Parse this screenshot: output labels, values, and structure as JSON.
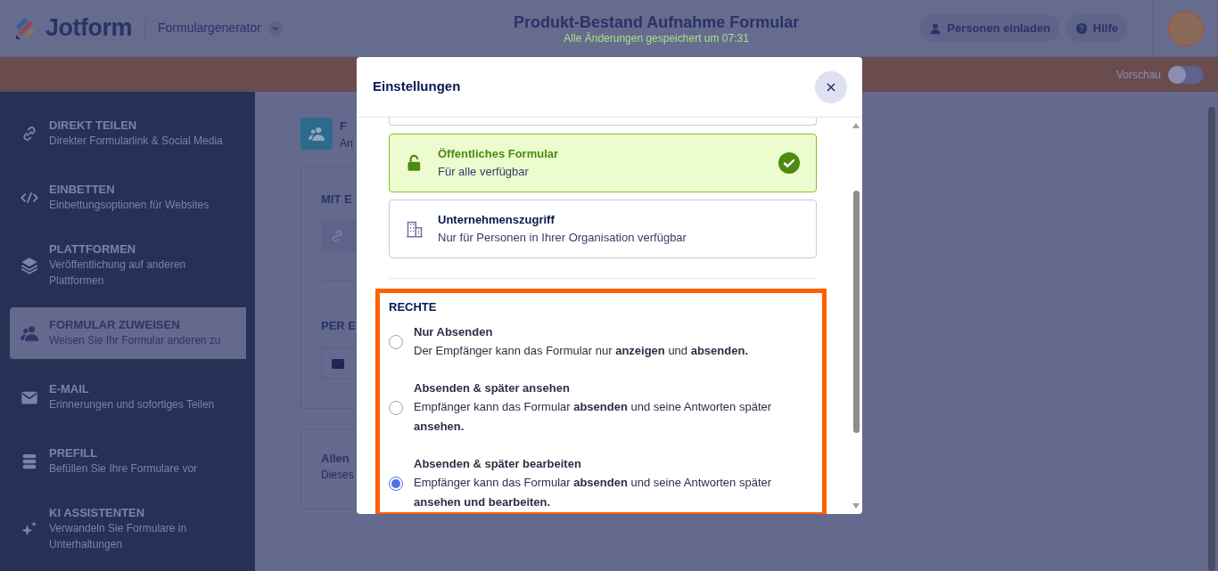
{
  "header": {
    "logo": "Jotform",
    "app_menu": "Formulargenerator",
    "form_title": "Produkt-Bestand Aufnahme Formular",
    "save_status": "Alle Änderungen gespeichert um 07:31",
    "buttons": [
      {
        "label": "Personen einladen"
      },
      {
        "label": "Hilfe"
      }
    ]
  },
  "toolbar": {
    "preview_label": "Vorschau",
    "preview_on": false
  },
  "sidebar": {
    "items": [
      {
        "title": "DIREKT TEILEN",
        "subtitle": "Direkter Formularlink & Social Media",
        "selected": false
      },
      {
        "title": "EINBETTEN",
        "subtitle": "Einbettungsoptionen für Websites",
        "selected": false
      },
      {
        "title": "PLATTFORMEN",
        "subtitle": "Veröffentlichung auf anderen Plattformen",
        "selected": false
      },
      {
        "title": "FORMULAR ZUWEISEN",
        "subtitle": "Weisen Sie Ihr Formular anderen zu",
        "selected": true
      },
      {
        "title": "E-MAIL",
        "subtitle": "Erinnerungen und sofortiges Teilen",
        "selected": false
      },
      {
        "title": "PREFILL",
        "subtitle": "Befüllen Sie Ihre Formulare vor",
        "selected": false
      },
      {
        "title": "KI ASSISTENTEN",
        "subtitle": "Verwandeln Sie Formulare in Unterhaltungen",
        "selected": false
      }
    ]
  },
  "background_panel": {
    "title": "F",
    "subtitle": "An",
    "sections": [
      {
        "heading": "MIT E"
      },
      {
        "heading": "PER E"
      }
    ],
    "card": {
      "title": "Allen",
      "text": "Dieses"
    }
  },
  "dialog": {
    "title": "Einstellungen",
    "access_options": [
      {
        "title": "Öffentliches Formular",
        "subtitle": "Für alle verfügbar",
        "selected": true
      },
      {
        "title": "Unternehmenszugriff",
        "subtitle": "Nur für Personen in Ihrer Organisation verfügbar",
        "selected": false
      }
    ],
    "permissions": {
      "heading": "RECHTE",
      "highlighted": true,
      "options": [
        {
          "title": "Nur Absenden",
          "description": "Der Empfänger kann das Formular nur **anzeigen** und **absenden.**",
          "selected": false
        },
        {
          "title": "Absenden & später ansehen",
          "description": "Empfänger kann das Formular **absenden** und seine Antworten später **ansehen.**",
          "selected": false
        },
        {
          "title": "Absenden & später bearbeiten",
          "description": "Empfänger kann das Formular **absenden** und seine Antworten später **ansehen und bearbeiten.**",
          "selected": true
        }
      ]
    }
  }
}
